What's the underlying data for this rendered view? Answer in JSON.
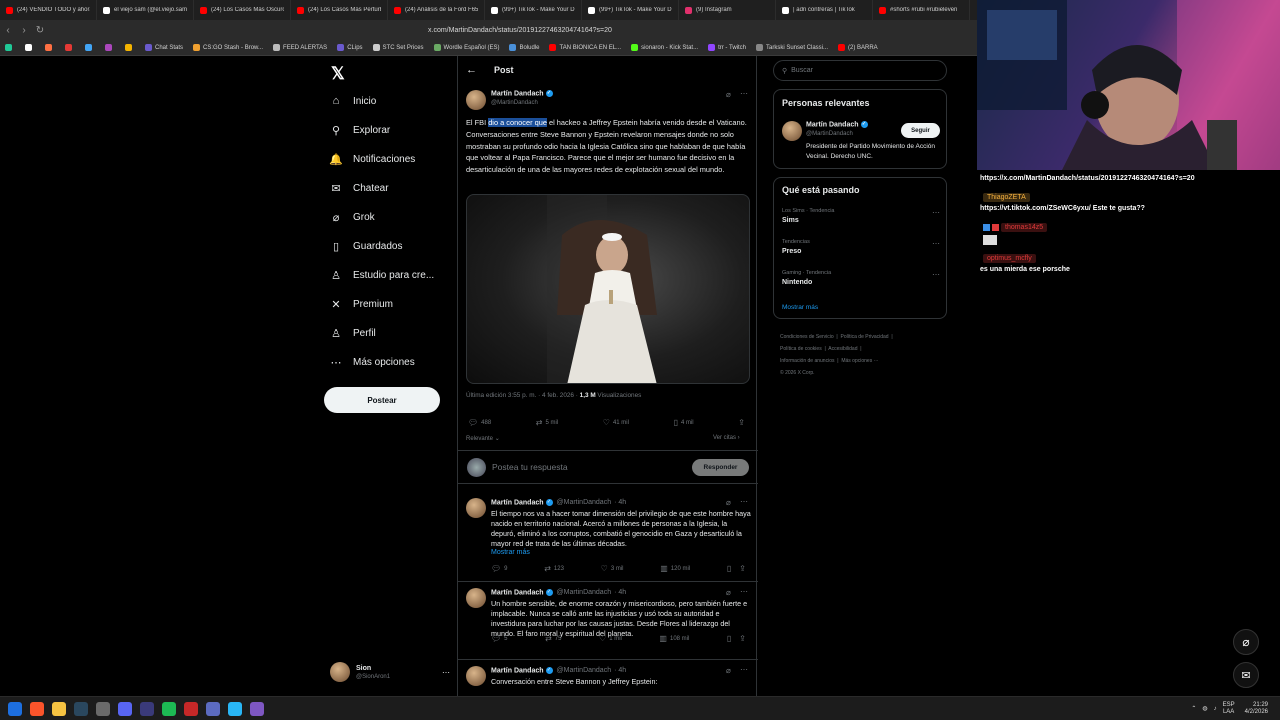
{
  "browser": {
    "tabs": [
      {
        "label": "(24) VENDIÓ TODO y ahora",
        "color": "#ff0000"
      },
      {
        "label": "el viejo sam (@el.viejo.sam",
        "color": "#ffffff"
      },
      {
        "label": "(24) Los Casos Más Oscuro",
        "color": "#ff0000"
      },
      {
        "label": "(24) Los Casos Más Perturb",
        "color": "#ff0000"
      },
      {
        "label": "(24) Análisis de la Ford F65",
        "color": "#ff0000"
      },
      {
        "label": "(99+) TikTok - Make Your D",
        "color": "#ffffff"
      },
      {
        "label": "(99+) TikTok - Make Your D",
        "color": "#ffffff"
      },
      {
        "label": "(9) Instagram",
        "color": "#e1306c"
      },
      {
        "label": "| adri contreras | TikTok",
        "color": "#ffffff"
      },
      {
        "label": "#shorts #rubi #rubieleven",
        "color": "#ff0000"
      }
    ],
    "url": "x.com/MartinDandach/status/2019122746320474164?s=20",
    "bookmarks": [
      {
        "label": "Chat Stats",
        "color": "#6a5acd"
      },
      {
        "label": "CS:GO Stash - Brow...",
        "color": "#f0a030"
      },
      {
        "label": "FEED ALERTAS",
        "color": "#bbbbbb"
      },
      {
        "label": "CLips",
        "color": "#6a5acd"
      },
      {
        "label": "STC Set Prices",
        "color": "#cccccc"
      },
      {
        "label": "Wordle Español (ES)",
        "color": "#6aaa64"
      },
      {
        "label": "Boludle",
        "color": "#4a90d9"
      },
      {
        "label": "TAN BIONICA EN EL...",
        "color": "#ff0000"
      },
      {
        "label": "sionaron - Kick Stat...",
        "color": "#53fc18"
      },
      {
        "label": "trr - Twitch",
        "color": "#9146ff"
      },
      {
        "label": "Tarkski Sunset Classi...",
        "color": "#888888"
      },
      {
        "label": "(2) BARRA",
        "color": "#ff0000"
      }
    ]
  },
  "left_nav": {
    "items": [
      {
        "label": "Inicio",
        "icon": "home-icon",
        "glyph": "⌂"
      },
      {
        "label": "Explorar",
        "icon": "search-icon",
        "glyph": "⚲"
      },
      {
        "label": "Notificaciones",
        "icon": "bell-icon",
        "glyph": "🔔"
      },
      {
        "label": "Chatear",
        "icon": "mail-icon",
        "glyph": "✉"
      },
      {
        "label": "Grok",
        "icon": "grok-icon",
        "glyph": "⌀"
      },
      {
        "label": "Guardados",
        "icon": "bookmark-icon",
        "glyph": "▯"
      },
      {
        "label": "Estudio para cre...",
        "icon": "studio-icon",
        "glyph": "♙"
      },
      {
        "label": "Premium",
        "icon": "x-premium-icon",
        "glyph": "✕"
      },
      {
        "label": "Perfil",
        "icon": "profile-icon",
        "glyph": "♙"
      },
      {
        "label": "Más opciones",
        "icon": "more-options-icon",
        "glyph": "⋯"
      }
    ],
    "post_button": "Postear",
    "user": {
      "name": "Sion",
      "handle": "@SionAron1"
    }
  },
  "post": {
    "header": "Post",
    "author": "Martín Dandach",
    "handle": "@MartinDandach",
    "text_before": "El FBI ",
    "text_highlight": "dio a conocer que",
    "text_after": " el hackeo a Jeffrey Epstein habría venido desde el Vaticano. Conversaciones entre Steve Bannon y Epstein revelaron mensajes donde no solo mostraban su profundo odio hacia la Iglesia Católica sino que hablaban de que había que voltear al Papa Francisco. Parece que el mejor ser humano fue decisivo en la desarticulación de una de las mayores redes de explotación sexual del mundo.",
    "meta": "Última edición 3:55 p. m. · 4 feb. 2026 · ",
    "views": "1,3 M",
    "views_label": " Visualizaciones",
    "stats": {
      "replies": "488",
      "reposts": "5 mil",
      "likes": "41 mil",
      "bookmarks": "4 mil"
    },
    "sort_label": "Relevante",
    "quotes_link": "Ver citas",
    "reply_placeholder": "Postea tu respuesta",
    "reply_button": "Responder"
  },
  "replies": [
    {
      "author": "Martín Dandach",
      "handle": "@MartinDandach",
      "time": "· 4h",
      "text": "El tiempo nos va a hacer tomar dimensión del privilegio de que este hombre haya nacido en territorio nacional. Acercó a millones de personas a la Iglesia, la depuró, eliminó a los corruptos, combatió el genocidio en Gaza y desarticuló la mayor red de trata de las últimas décadas.",
      "more": "Mostrar más",
      "stats": {
        "replies": "9",
        "reposts": "123",
        "likes": "3 mil",
        "views": "120 mil"
      }
    },
    {
      "author": "Martín Dandach",
      "handle": "@MartinDandach",
      "time": "· 4h",
      "text": "Un hombre sensible, de enorme corazón y misericordioso, pero también fuerte e implacable. Nunca se calló ante las injusticias y usó toda su autoridad e investidura para luchar por las causas justas. Desde Flores al liderazgo del mundo. El faro moral y espiritual del planeta.",
      "more": "",
      "stats": {
        "replies": "5",
        "reposts": "75",
        "likes": "1 mil",
        "views": "108 mil"
      }
    },
    {
      "author": "Martín Dandach",
      "handle": "@MartinDandach",
      "time": "· 4h",
      "text": "Conversación entre Steve Bannon y Jeffrey Epstein:",
      "more": "",
      "stats": {}
    }
  ],
  "right": {
    "search_placeholder": "Buscar",
    "relevant_title": "Personas relevantes",
    "relevant_person": {
      "name": "Martín Dandach",
      "handle": "@MartinDandach",
      "bio": "Presidente del Partido Movimiento de Acción Vecinal. Derecho UNC.",
      "follow": "Seguir"
    },
    "trending_title": "Qué está pasando",
    "trends": [
      {
        "context": "Los Sims · Tendencia",
        "name": "Sims"
      },
      {
        "context": "Tendencias",
        "name": "Preso"
      },
      {
        "context": "Gaming · Tendencia",
        "name": "Nintendo"
      }
    ],
    "show_more": "Mostrar más",
    "footer": [
      "Condiciones de Servicio",
      "Política de Privacidad",
      "Política de cookies",
      "Accesibilidad",
      "Información de anuncios",
      "Más opciones ···",
      "© 2026 X Corp."
    ]
  },
  "chat": {
    "lines": [
      {
        "type": "text",
        "text": "https://x.com/MartinDandach/status/2019122746320474164?s=20"
      },
      {
        "type": "badge",
        "text": "ThiagoZETA",
        "color": "#f4b03e",
        "bg": "#3a2a10"
      },
      {
        "type": "text",
        "text": "https://vt.tiktok.com/ZSeWC6yxu/ Este te gusta??"
      },
      {
        "type": "badge",
        "text": "thomas14z5",
        "color": "#e03a3a",
        "bg": "#3a1010"
      },
      {
        "type": "badge",
        "text": "optimus_mcfly",
        "color": "#e03a3a",
        "bg": "#3a1010"
      },
      {
        "type": "text",
        "text": "es una mierda ese porsche"
      }
    ]
  },
  "taskbar": {
    "lang": "ESP",
    "layout": "LAA",
    "time": "21:29",
    "date": "4/2/2026"
  }
}
